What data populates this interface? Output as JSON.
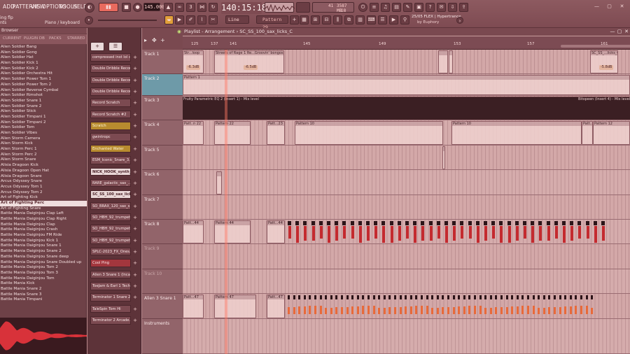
{
  "menu": {
    "items": [
      "ADD",
      "PATTERNS",
      "VIEW",
      "OPTIONS",
      "TOOLS",
      "HELP"
    ],
    "song_line1": "ing flp",
    "song_line2": "nts",
    "hint": "Piano / keyboard"
  },
  "transport": {
    "tempo": "145.000",
    "time": "140:15:18",
    "pattern": "Pattern 29",
    "snap": "Line",
    "cpu": "41",
    "memory": "3587 MB",
    "poly": "18"
  },
  "news": {
    "line1": "25/05  FLEX | Hypertrance",
    "line2": "by Euphory"
  },
  "browser": {
    "title": "Browser",
    "tabs": [
      "CURRENT",
      "PLUGIN DB",
      "PACKS",
      "STARRED"
    ],
    "items": [
      "Alien Soldier Bang",
      "Alien Soldier Gong",
      "Alien Soldier Hat",
      "Alien Soldier Kick 1",
      "Alien Soldier Kick 2",
      "Alien Soldier Orchestra Hit",
      "Alien Soldier Power Tom 1",
      "Alien Soldier Power Tom 2",
      "Alien Soldier Reverse Cymbal",
      "Alien Soldier Rimshot",
      "Alien Soldier Snare 1",
      "Alien Soldier Snare 2",
      "Alien Soldier Stick",
      "Alien Soldier Timpani 1",
      "Alien Soldier Timpani 2",
      "Alien Soldier Tom",
      "Alien Soldier Vibes",
      "Alien Storm Camera",
      "Alien Storm Kick",
      "Alien Storm Perc 1",
      "Alien Storm Perc 2",
      "Alien Storm Snare",
      "Alisia Dragoon Kick",
      "Alisia Dragoon Open Hat",
      "Alisia Dragoon Snare",
      "Arcus Odyssey Snare",
      "Arcus Odyssey Tom 1",
      "Arcus Odyssey Tom 2",
      "Art of Fighting Kick",
      "Art of Fighting Perc",
      "Art of Fighting Snare",
      "Battle Mania Daiginjou Clap Left",
      "Battle Mania Daiginjou Clap Right",
      "Battle Mania Daiginjou Clap",
      "Battle Mania Daiginjou Crash",
      "Battle Mania Daiginjou FM Ride",
      "Battle Mania Daiginjou Kick 1",
      "Battle Mania Daiginjou Snare 1",
      "Battle Mania Daiginjou Snare 2",
      "Battle Mania Daiginjou Snare deep",
      "Battle Mania Daiginjou Snare Doubled up",
      "Battle Mania Daiginjou Tom 2",
      "Battle Mania Daiginjou Tom 3",
      "Battle Mania Daiginjou Tom",
      "Battle Mania Kick",
      "Battle Mania Snare 2",
      "Battle Mania Snare 3",
      "Battle Mania Timpani"
    ],
    "selected_index": 29
  },
  "rack": {
    "channels": [
      "compressed inst lol c...",
      "Double Dribble Recor...",
      "Double Dribble Recor...",
      "Double Dribble Recor...",
      "Record Scratch",
      "Record Scratch #2",
      "Scratch",
      "gwintropc",
      "Enchanted Water",
      "ESM_Iconic_Snare_3...",
      "NICK_HOOK_synth_l...",
      "RARE_galactic_sax_...",
      "SC_SS_100_sax_licks...",
      "SO_BRAX_120_sax_s...",
      "SO_HBH_92_trumpet...",
      "SO_HBH_92_trumpet...",
      "SO_HBH_92_trumpet...",
      "SPLC-2023_FX_Ones...",
      "Cool Ping",
      "Alien 3 Snare 1 (Inca...",
      "ToeJam & Earl 1 Tech...",
      "Terminator 1 Snare 2",
      "TaleSpin Tom Hi",
      "Terminator 2 Arcade..."
    ]
  },
  "playlist": {
    "title": "Playlist - Arrangement",
    "pattern_name": "SC_SS_100_sax_licks_C",
    "bar_numbers": [
      "125",
      "137",
      "141",
      "145",
      "149",
      "153",
      "157",
      "161"
    ],
    "tracks": [
      "Track 1",
      "Track 2",
      "Track 3",
      "Track 4",
      "Track 5",
      "Track 6",
      "Track 7",
      "Track 8",
      "Track 9",
      "Track 10",
      "Alien 3 Snare 1",
      "Instruments"
    ],
    "clips": {
      "t1_a": "Str...loop",
      "t1_b": "Streets of Rage 1 Re...Groovin' bongos loop",
      "t1_c": "SC_SS_...licks_C",
      "t1_gain1": "-6.3dB",
      "t1_gain2": "-6.5dB",
      "t1_gain3": "-5.8dB",
      "t2_a": "Pattern 1",
      "t3_a": "Fruity Parametric EQ 2 (Insert 1) - Mix level",
      "t3_b": "Bitopeen (Insert 4) - Mix level",
      "t4_a": "Patt..n 22",
      "t4_b": "Pattern 22",
      "t4_c": "Patt...23",
      "t4_d": "Pattern 10",
      "t4_e": "Pattern 10",
      "t4_f": "Patt..8",
      "t4_g": "Pattern 12",
      "t8_a": "Patt...44",
      "t8_b": "Pattern 44",
      "t8_c": "Patt...44",
      "t11_a": "Patt...47",
      "t11_b": "Pattern 47",
      "t11_c": "Patt...47"
    }
  },
  "colors": {
    "accent": "#f07e7e",
    "playhead": "#ff7a64",
    "note_red": "#c42a2f",
    "note_orange": "#e86a3a"
  }
}
